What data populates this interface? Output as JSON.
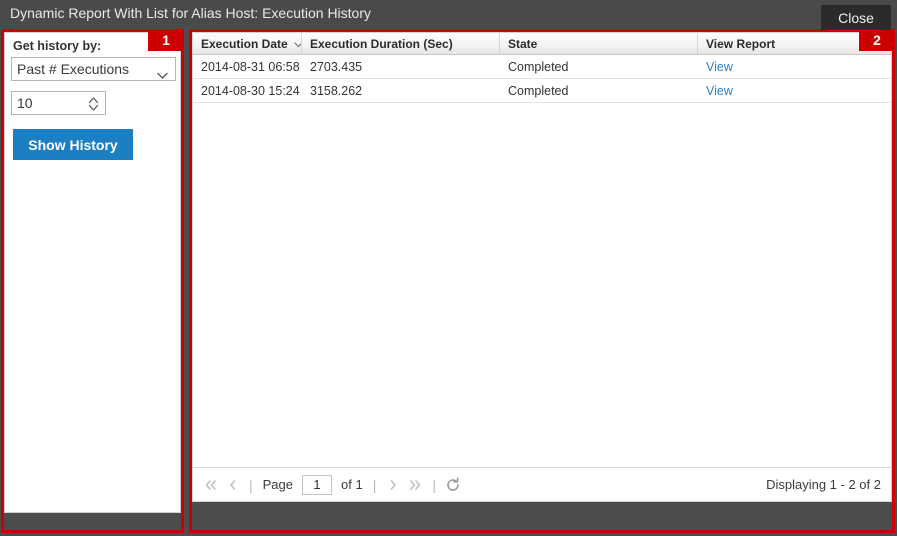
{
  "window": {
    "title": "Dynamic Report With List for Alias Host: Execution History",
    "maximize_icon": "expand-arrows-icon",
    "close_icon": "close-x-icon"
  },
  "annotations": [
    {
      "label": "1",
      "target": "left-filter-panel"
    },
    {
      "label": "2",
      "target": "execution-history-grid"
    }
  ],
  "left_panel": {
    "label": "Get history by:",
    "history_by": {
      "value": "Past # Executions",
      "chevron_icon": "chevron-down-icon"
    },
    "count": {
      "value": "10",
      "stepper_icon": "stepper-up-down-icon"
    },
    "show_history_label": "Show History"
  },
  "grid": {
    "columns": [
      {
        "label": "Execution Date",
        "sort_icon": "chevron-down-icon"
      },
      {
        "label": "Execution Duration (Sec)",
        "sort_icon": ""
      },
      {
        "label": "State",
        "sort_icon": ""
      },
      {
        "label": "View Report",
        "sort_icon": ""
      }
    ],
    "rows": [
      {
        "execution_date": "2014-08-31 06:58",
        "duration": "2703.435",
        "state": "Completed",
        "view_link": "View"
      },
      {
        "execution_date": "2014-08-30 15:24",
        "duration": "3158.262",
        "state": "Completed",
        "view_link": "View"
      }
    ]
  },
  "pager": {
    "first_icon": "double-chevron-left-icon",
    "prev_icon": "chevron-left-icon",
    "page_label": "Page",
    "page_value": "1",
    "of_label": "of 1",
    "next_icon": "chevron-right-icon",
    "last_icon": "double-chevron-right-icon",
    "refresh_icon": "refresh-icon",
    "separator": "|",
    "displaying": "Displaying 1 - 2 of 2"
  },
  "footer": {
    "close_label": "Close"
  },
  "colors": {
    "window_chrome": "#4d4d4d",
    "annotation_red": "#cc0000",
    "primary_button": "#1b7fc2",
    "link": "#2d7fc1",
    "close_button": "#2b2b2b"
  }
}
